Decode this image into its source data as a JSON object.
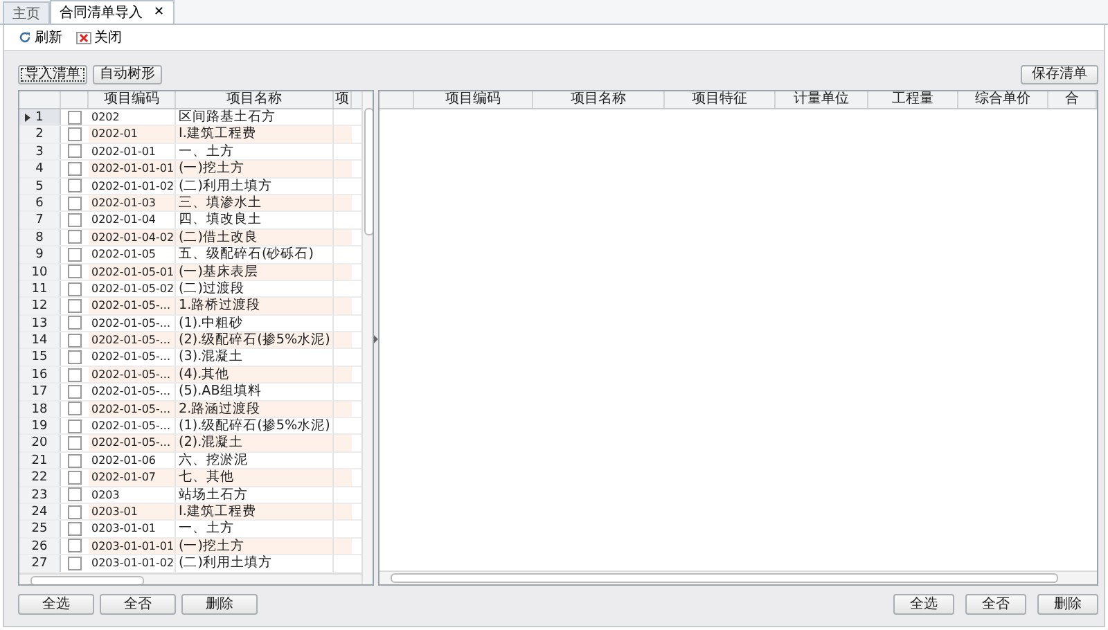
{
  "tabs": [
    {
      "label": "主页",
      "selected": false,
      "closable": false
    },
    {
      "label": "合同清单导入",
      "selected": true,
      "closable": true,
      "close_glyph": "✕"
    }
  ],
  "toolbar": [
    {
      "kind": "refresh",
      "label": "刷新"
    },
    {
      "kind": "close",
      "label": "关闭"
    }
  ],
  "left_buttons": [
    "导入清单",
    "自动树形"
  ],
  "right_buttons": [
    "保存清单"
  ],
  "left_grid": {
    "columns": [
      "项目编码",
      "项目名称",
      "项"
    ],
    "rows": [
      {
        "num": "1",
        "code": "0202",
        "name": "区间路基土石方",
        "checked": false,
        "selected": true
      },
      {
        "num": "2",
        "code": "0202-01",
        "name": "Ⅰ.建筑工程费",
        "checked": false,
        "selected": false
      },
      {
        "num": "3",
        "code": "0202-01-01",
        "name": "一、土方",
        "checked": false,
        "selected": false
      },
      {
        "num": "4",
        "code": "0202-01-01-01",
        "name": "(一)挖土方",
        "checked": false,
        "selected": false
      },
      {
        "num": "5",
        "code": "0202-01-01-02",
        "name": "(二)利用土填方",
        "checked": false,
        "selected": false
      },
      {
        "num": "6",
        "code": "0202-01-03",
        "name": "三、填渗水土",
        "checked": false,
        "selected": false
      },
      {
        "num": "7",
        "code": "0202-01-04",
        "name": "四、填改良土",
        "checked": false,
        "selected": false
      },
      {
        "num": "8",
        "code": "0202-01-04-02",
        "name": "(二)借土改良",
        "checked": false,
        "selected": false
      },
      {
        "num": "9",
        "code": "0202-01-05",
        "name": "五、级配碎石(砂砾石)",
        "checked": false,
        "selected": false
      },
      {
        "num": "10",
        "code": "0202-01-05-01",
        "name": "(一)基床表层",
        "checked": false,
        "selected": false
      },
      {
        "num": "11",
        "code": "0202-01-05-02",
        "name": "(二)过渡段",
        "checked": false,
        "selected": false
      },
      {
        "num": "12",
        "code": "0202-01-05-...",
        "name": "1.路桥过渡段",
        "checked": false,
        "selected": false
      },
      {
        "num": "13",
        "code": "0202-01-05-...",
        "name": "(1).中粗砂",
        "checked": false,
        "selected": false
      },
      {
        "num": "14",
        "code": "0202-01-05-...",
        "name": "(2).级配碎石(掺5%水泥)",
        "checked": false,
        "selected": false
      },
      {
        "num": "15",
        "code": "0202-01-05-...",
        "name": "(3).混凝土",
        "checked": false,
        "selected": false
      },
      {
        "num": "16",
        "code": "0202-01-05-...",
        "name": "(4).其他",
        "checked": false,
        "selected": false
      },
      {
        "num": "17",
        "code": "0202-01-05-...",
        "name": "(5).AB组填料",
        "checked": false,
        "selected": false
      },
      {
        "num": "18",
        "code": "0202-01-05-...",
        "name": "2.路涵过渡段",
        "checked": false,
        "selected": false
      },
      {
        "num": "19",
        "code": "0202-01-05-...",
        "name": "(1).级配碎石(掺5%水泥)",
        "checked": false,
        "selected": false
      },
      {
        "num": "20",
        "code": "0202-01-05-...",
        "name": "(2).混凝土",
        "checked": false,
        "selected": false
      },
      {
        "num": "21",
        "code": "0202-01-06",
        "name": "六、挖淤泥",
        "checked": false,
        "selected": false
      },
      {
        "num": "22",
        "code": "0202-01-07",
        "name": "七、其他",
        "checked": false,
        "selected": false
      },
      {
        "num": "23",
        "code": "0203",
        "name": "站场土石方",
        "checked": false,
        "selected": false
      },
      {
        "num": "24",
        "code": "0203-01",
        "name": "Ⅰ.建筑工程费",
        "checked": false,
        "selected": false
      },
      {
        "num": "25",
        "code": "0203-01-01",
        "name": "一、土方",
        "checked": false,
        "selected": false
      },
      {
        "num": "26",
        "code": "0203-01-01-01",
        "name": "(一)挖土方",
        "checked": false,
        "selected": false
      },
      {
        "num": "27",
        "code": "0203-01-01-02",
        "name": "(二)利用土填方",
        "checked": false,
        "selected": false
      }
    ]
  },
  "right_grid": {
    "columns": [
      "项目编码",
      "项目名称",
      "项目特征",
      "计量单位",
      "工程量",
      "综合单价",
      "合"
    ]
  },
  "left_footer_buttons": [
    "全选",
    "全否",
    "删除"
  ],
  "right_footer_buttons": [
    "全选",
    "全否",
    "删除"
  ]
}
